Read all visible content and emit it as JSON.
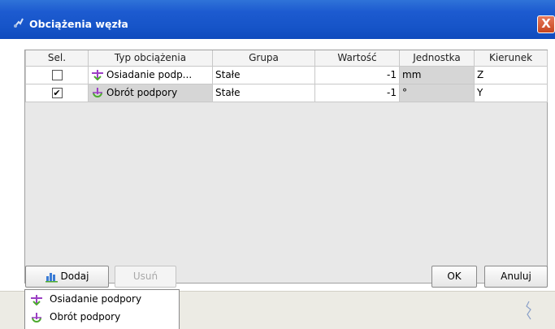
{
  "window": {
    "title": "Obciążenia węzła",
    "close_label": "X"
  },
  "table": {
    "columns": [
      "Sel.",
      "Typ obciążenia",
      "Grupa",
      "Wartość",
      "Jednostka",
      "Kierunek"
    ],
    "rows": [
      {
        "selected": false,
        "sel_mark": "",
        "icon": "support-settlement-icon",
        "type": "Osiadanie podp...",
        "group": "Stałe",
        "value": "-1",
        "unit": "mm",
        "direction": "Z"
      },
      {
        "selected": true,
        "sel_mark": "✔",
        "icon": "support-rotation-icon",
        "type": "Obrót podpory",
        "group": "Stałe",
        "value": "-1",
        "unit": "°",
        "direction": "Y"
      }
    ]
  },
  "buttons": {
    "add_label": "Dodaj",
    "add_icon": "add-load-icon",
    "remove_label": "Usuń",
    "ok_label": "OK",
    "cancel_label": "Anuluj"
  },
  "dropdown": {
    "items": [
      {
        "icon": "support-settlement-icon",
        "label": "Osiadanie podpory"
      },
      {
        "icon": "support-rotation-icon",
        "label": "Obrót podpory"
      }
    ]
  },
  "colors": {
    "titlebar": "#1654c8",
    "settlement_icon": "#9b3fc4",
    "rotation_icon": "#4caa2e"
  }
}
